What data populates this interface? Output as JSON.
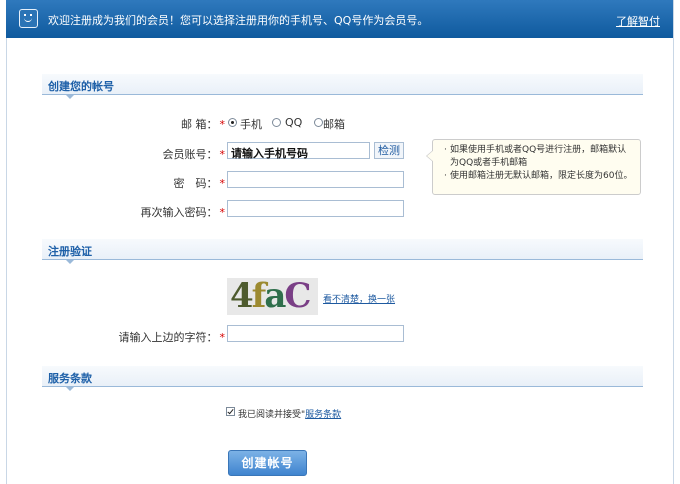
{
  "header": {
    "message": "欢迎注册成为我们的会员！您可以选择注册用你的手机号、QQ号作为会员号。",
    "learn_link": "了解智付"
  },
  "sections": {
    "create_account": "创建您的帐号",
    "verification": "注册验证",
    "terms": "服务条款"
  },
  "form": {
    "mailbox_label": "邮 箱：",
    "required_mark": "*",
    "mailbox_options": [
      "手机",
      "QQ",
      "邮箱"
    ],
    "mailbox_selected": "手机",
    "account_label": "会员账号：",
    "account_value": "请输入手机号码",
    "check_button": "检测",
    "password_label": "密　码：",
    "password_confirm_label": "再次输入密码：",
    "captcha_input_label": "请输入上边的字符："
  },
  "tip": {
    "lines": [
      "如果使用手机或者QQ号进行注册，邮箱默认为QQ或者手机邮箱",
      "使用邮箱注册无默认邮箱，限定长度为60位。"
    ]
  },
  "captcha": {
    "chars": [
      "4",
      "f",
      "a",
      "C"
    ],
    "refresh_link": "看不清楚，换一张"
  },
  "terms": {
    "checked": true,
    "agree_text": "我已阅读并接受\"",
    "link_text": "服务条款"
  },
  "submit_button": "创建帐号"
}
